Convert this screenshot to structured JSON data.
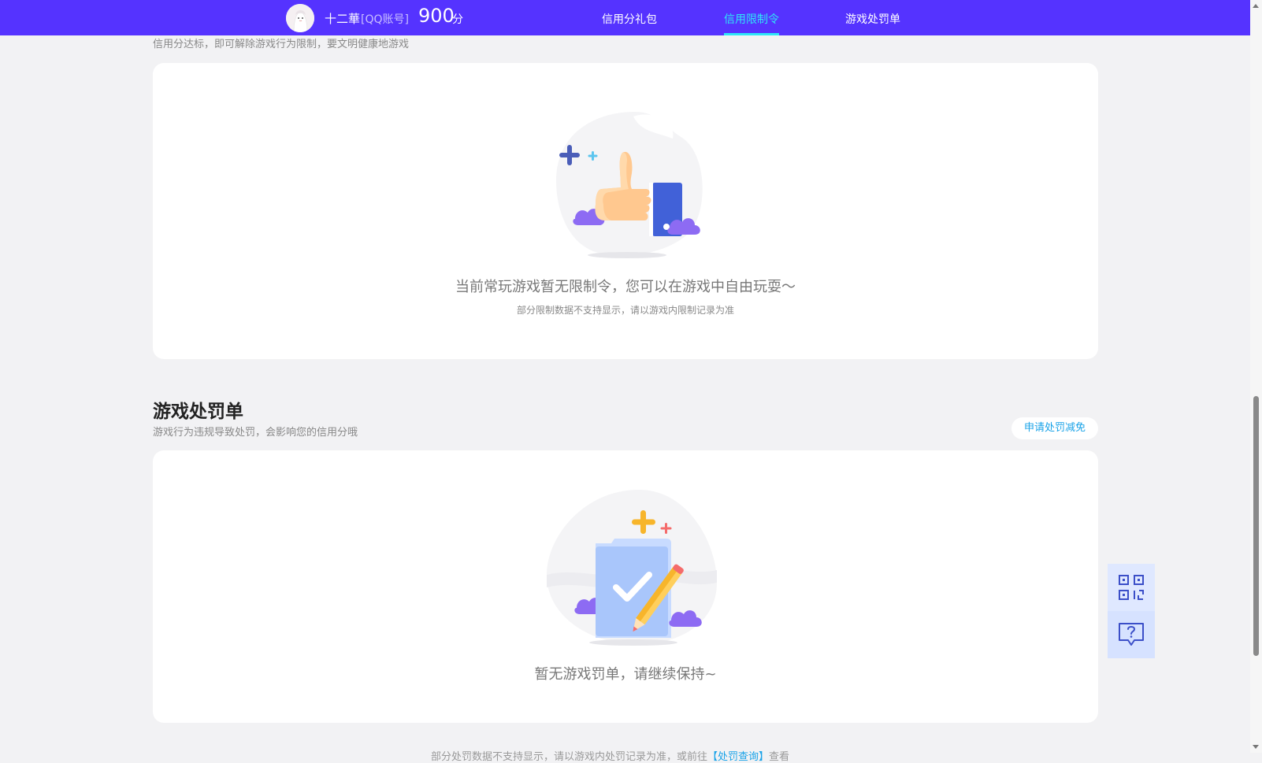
{
  "header": {
    "username": "十二華",
    "account_type": "[QQ账号]",
    "score": "900",
    "score_unit": "分",
    "tabs": [
      {
        "label": "信用分礼包",
        "active": false
      },
      {
        "label": "信用限制令",
        "active": true
      },
      {
        "label": "游戏处罚单",
        "active": false
      }
    ]
  },
  "restriction_section": {
    "subtitle": "信用分达标，即可解除游戏行为限制，要文明健康地游戏",
    "empty_title": "当前常玩游戏暂无限制令，您可以在游戏中自由玩耍～",
    "empty_note": "部分限制数据不支持显示，请以游戏内限制记录为准"
  },
  "penalty_section": {
    "title": "游戏处罚单",
    "subtitle": "游戏行为违规导致处罚，会影响您的信用分哦",
    "appeal_button": "申请处罚减免",
    "empty_title": "暂无游戏罚单，请继续保持~"
  },
  "footer": {
    "text_before": "部分处罚数据不支持显示，请以游戏内处罚记录为准，或前往",
    "link": "【处罚查询】",
    "text_after": "查看"
  },
  "floating_tools": [
    {
      "icon": "qr-code-icon"
    },
    {
      "icon": "help-chat-icon"
    }
  ],
  "colors": {
    "brand": "#5533ff",
    "active_tab": "#2ee6f7",
    "link": "#1aa3e8",
    "background": "#f2f2f4"
  }
}
